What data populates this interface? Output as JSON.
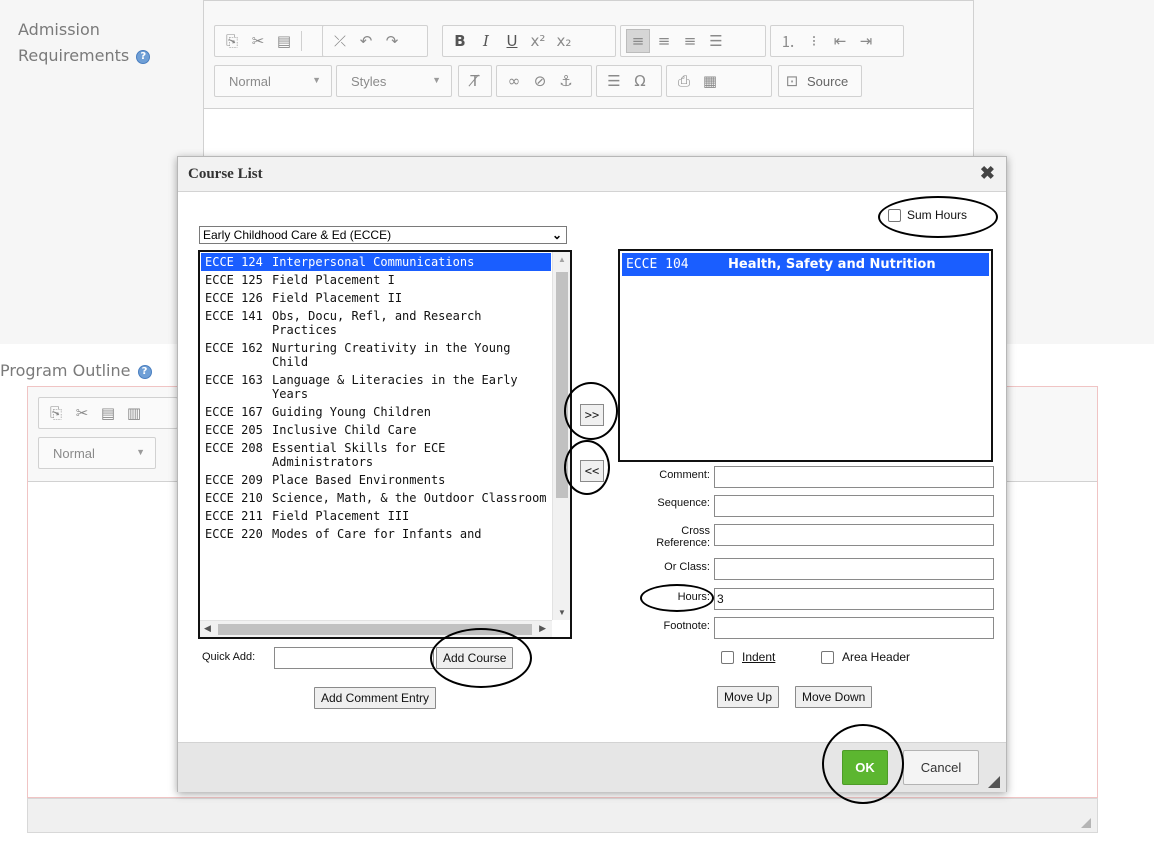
{
  "page": {
    "admission_label_line1": "Admission",
    "admission_label_line2": "Requirements",
    "program_outline_label": "Program Outline",
    "help_glyph": "?"
  },
  "editor": {
    "format_combo": "Normal",
    "styles_combo": "Styles",
    "source_label": "Source",
    "icons": [
      "copy-icon",
      "cut-icon",
      "paste-icon",
      "remove-format-icon",
      "undo-icon",
      "redo-icon",
      "bold-icon",
      "italic-icon",
      "underline-icon",
      "superscript-icon",
      "subscript-icon",
      "align-left-icon",
      "align-center-icon",
      "align-right-icon",
      "justify-icon",
      "numbered-list-icon",
      "bulleted-list-icon",
      "outdent-icon",
      "indent-icon",
      "clear-format-icon",
      "link-icon",
      "unlink-icon",
      "anchor-icon",
      "horizontal-rule-icon",
      "special-char-icon",
      "template-icon",
      "table-icon",
      "source-icon"
    ]
  },
  "dialog": {
    "title": "Course List",
    "close_glyph": "✖",
    "department": "Early Childhood Care & Ed (ECCE)",
    "sum_hours_label": "Sum Hours",
    "sum_hours_checked": false,
    "available_courses": [
      {
        "code": "ECCE 124",
        "name": "Interpersonal Communications",
        "selected": true
      },
      {
        "code": "ECCE 125",
        "name": "Field Placement I"
      },
      {
        "code": "ECCE 126",
        "name": "Field Placement II"
      },
      {
        "code": "ECCE 141",
        "name": "Obs, Docu, Refl, and Research Practices"
      },
      {
        "code": "ECCE 162",
        "name": "Nurturing Creativity in the Young Child"
      },
      {
        "code": "ECCE 163",
        "name": "Language & Literacies in the Early Years"
      },
      {
        "code": "ECCE 167",
        "name": "Guiding Young Children"
      },
      {
        "code": "ECCE 205",
        "name": "Inclusive Child Care"
      },
      {
        "code": "ECCE 208",
        "name": "Essential Skills for ECE Administrators"
      },
      {
        "code": "ECCE 209",
        "name": "Place Based Environments"
      },
      {
        "code": "ECCE 210",
        "name": "Science, Math, & the Outdoor Classroom"
      },
      {
        "code": "ECCE 211",
        "name": "Field Placement III"
      },
      {
        "code": "ECCE 220",
        "name": "Modes of Care for Infants and"
      }
    ],
    "selected_courses": [
      {
        "code": "ECCE 104",
        "name": "Health, Safety and Nutrition"
      }
    ],
    "add_button": ">>",
    "remove_button": "<<",
    "fields": {
      "comment_label": "Comment:",
      "comment_value": "",
      "sequence_label": "Sequence:",
      "sequence_value": "",
      "cross_ref_label_line1": "Cross",
      "cross_ref_label_line2": "Reference:",
      "cross_ref_value": "",
      "or_class_label": "Or Class:",
      "or_class_value": "",
      "hours_label": "Hours:",
      "hours_value": "3",
      "footnote_label": "Footnote:",
      "footnote_value": ""
    },
    "indent_label": "Indent",
    "area_header_label": "Area Header",
    "move_up_label": "Move Up",
    "move_down_label": "Move Down",
    "quick_add_label": "Quick Add:",
    "quick_add_value": "",
    "add_course_label": "Add Course",
    "add_comment_entry_label": "Add Comment Entry",
    "ok_label": "OK",
    "cancel_label": "Cancel"
  },
  "colors": {
    "selection_blue": "#1a5eff",
    "ok_green": "#5cb630"
  }
}
